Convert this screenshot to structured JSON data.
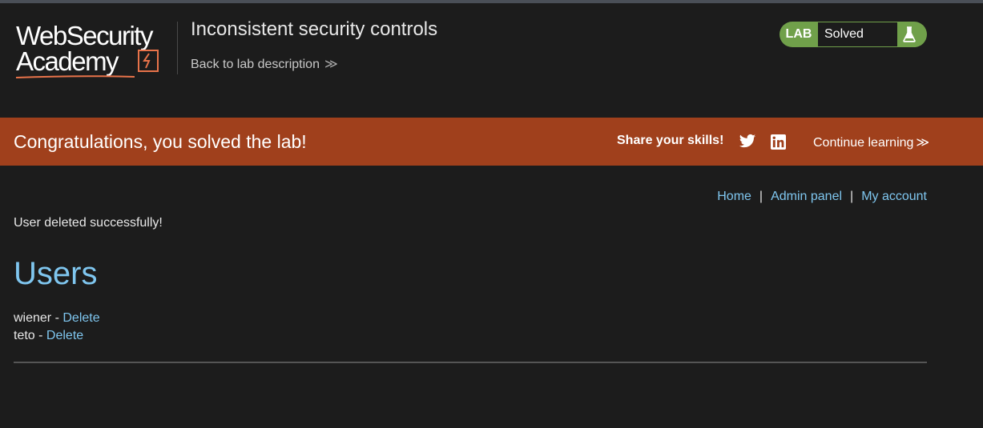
{
  "header": {
    "logo_line1": "WebSecurity",
    "logo_line2": "Academy",
    "lab_title": "Inconsistent security controls",
    "back_link": "Back to lab description",
    "back_chevron": "≫"
  },
  "status": {
    "badge": "LAB",
    "state": "Solved",
    "icon": "flask-icon",
    "color": "#70a04a"
  },
  "banner": {
    "message": "Congratulations, you solved the lab!",
    "share": "Share your skills!",
    "continue": "Continue learning",
    "continue_chevron": "≫",
    "color": "#a0401c"
  },
  "nav": {
    "home": "Home",
    "admin": "Admin panel",
    "account": "My account",
    "separator": "|"
  },
  "main": {
    "message": "User deleted successfully!",
    "heading": "Users",
    "users": [
      {
        "name": "wiener",
        "dash": " - ",
        "action": "Delete"
      },
      {
        "name": "teto",
        "dash": " - ",
        "action": "Delete"
      }
    ]
  },
  "colors": {
    "link": "#7fc6ef",
    "background": "#1c1c1c"
  }
}
